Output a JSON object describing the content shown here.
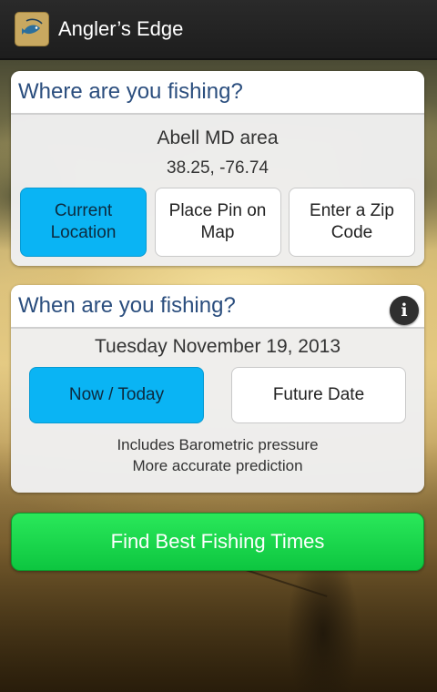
{
  "app": {
    "title": "Angler’s Edge",
    "icon": "fish-logo-icon"
  },
  "where": {
    "heading": "Where are you fishing?",
    "area_name": "Abell MD area",
    "coordinates": "38.25, -76.74",
    "buttons": {
      "current_location": "Current Location",
      "place_pin": "Place Pin on Map",
      "zip_code": "Enter a Zip Code"
    },
    "selected": "current_location"
  },
  "when": {
    "heading": "When are you fishing?",
    "info_icon": "info-icon",
    "date": "Tuesday November 19, 2013",
    "buttons": {
      "now_today": "Now / Today",
      "future_date": "Future Date"
    },
    "selected": "now_today",
    "note_line1": "Includes Barometric pressure",
    "note_line2": "More accurate prediction"
  },
  "actions": {
    "find_label": "Find Best Fishing Times"
  },
  "colors": {
    "accent_blue": "#0ab4f4",
    "heading_blue": "#2b4e7e",
    "find_green": "#0dc640"
  }
}
